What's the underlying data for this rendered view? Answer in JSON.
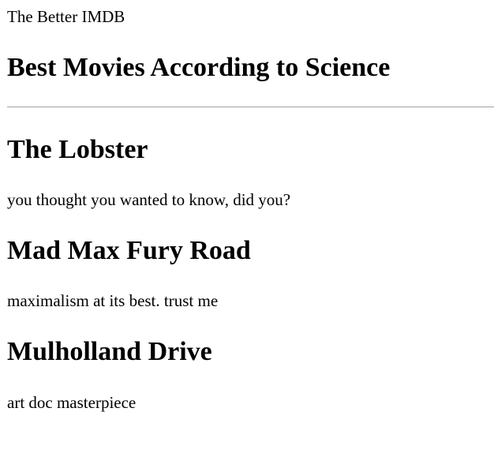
{
  "header": {
    "site_name": "The Better IMDB",
    "page_title": "Best Movies According to Science"
  },
  "movies": [
    {
      "title": "The Lobster",
      "description": "you thought you wanted to know, did you?"
    },
    {
      "title": "Mad Max Fury Road",
      "description": "maximalism at its best. trust me"
    },
    {
      "title": "Mulholland Drive",
      "description": "art doc masterpiece"
    }
  ]
}
